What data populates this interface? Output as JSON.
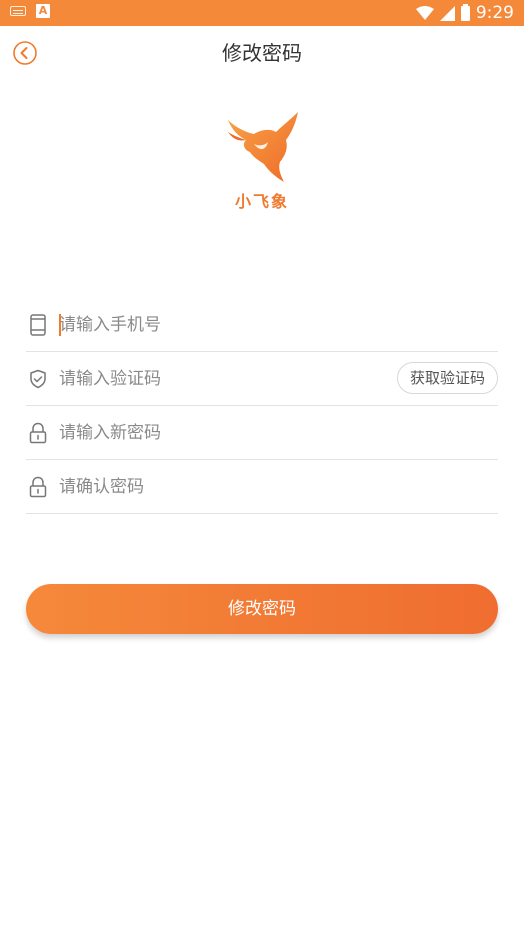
{
  "status_bar": {
    "time": "9:29",
    "app_badge": "A"
  },
  "header": {
    "title": "修改密码"
  },
  "logo": {
    "name": "小飞象"
  },
  "form": {
    "phone": {
      "placeholder": "请输入手机号",
      "value": ""
    },
    "code": {
      "placeholder": "请输入验证码",
      "value": "",
      "button_label": "获取验证码"
    },
    "new_password": {
      "placeholder": "请输入新密码",
      "value": ""
    },
    "confirm_password": {
      "placeholder": "请确认密码",
      "value": ""
    }
  },
  "submit": {
    "label": "修改密码"
  },
  "colors": {
    "accent": "#f5893a",
    "accent_dark": "#ef6d30",
    "text": "#333333",
    "placeholder": "#8a8a8a"
  }
}
